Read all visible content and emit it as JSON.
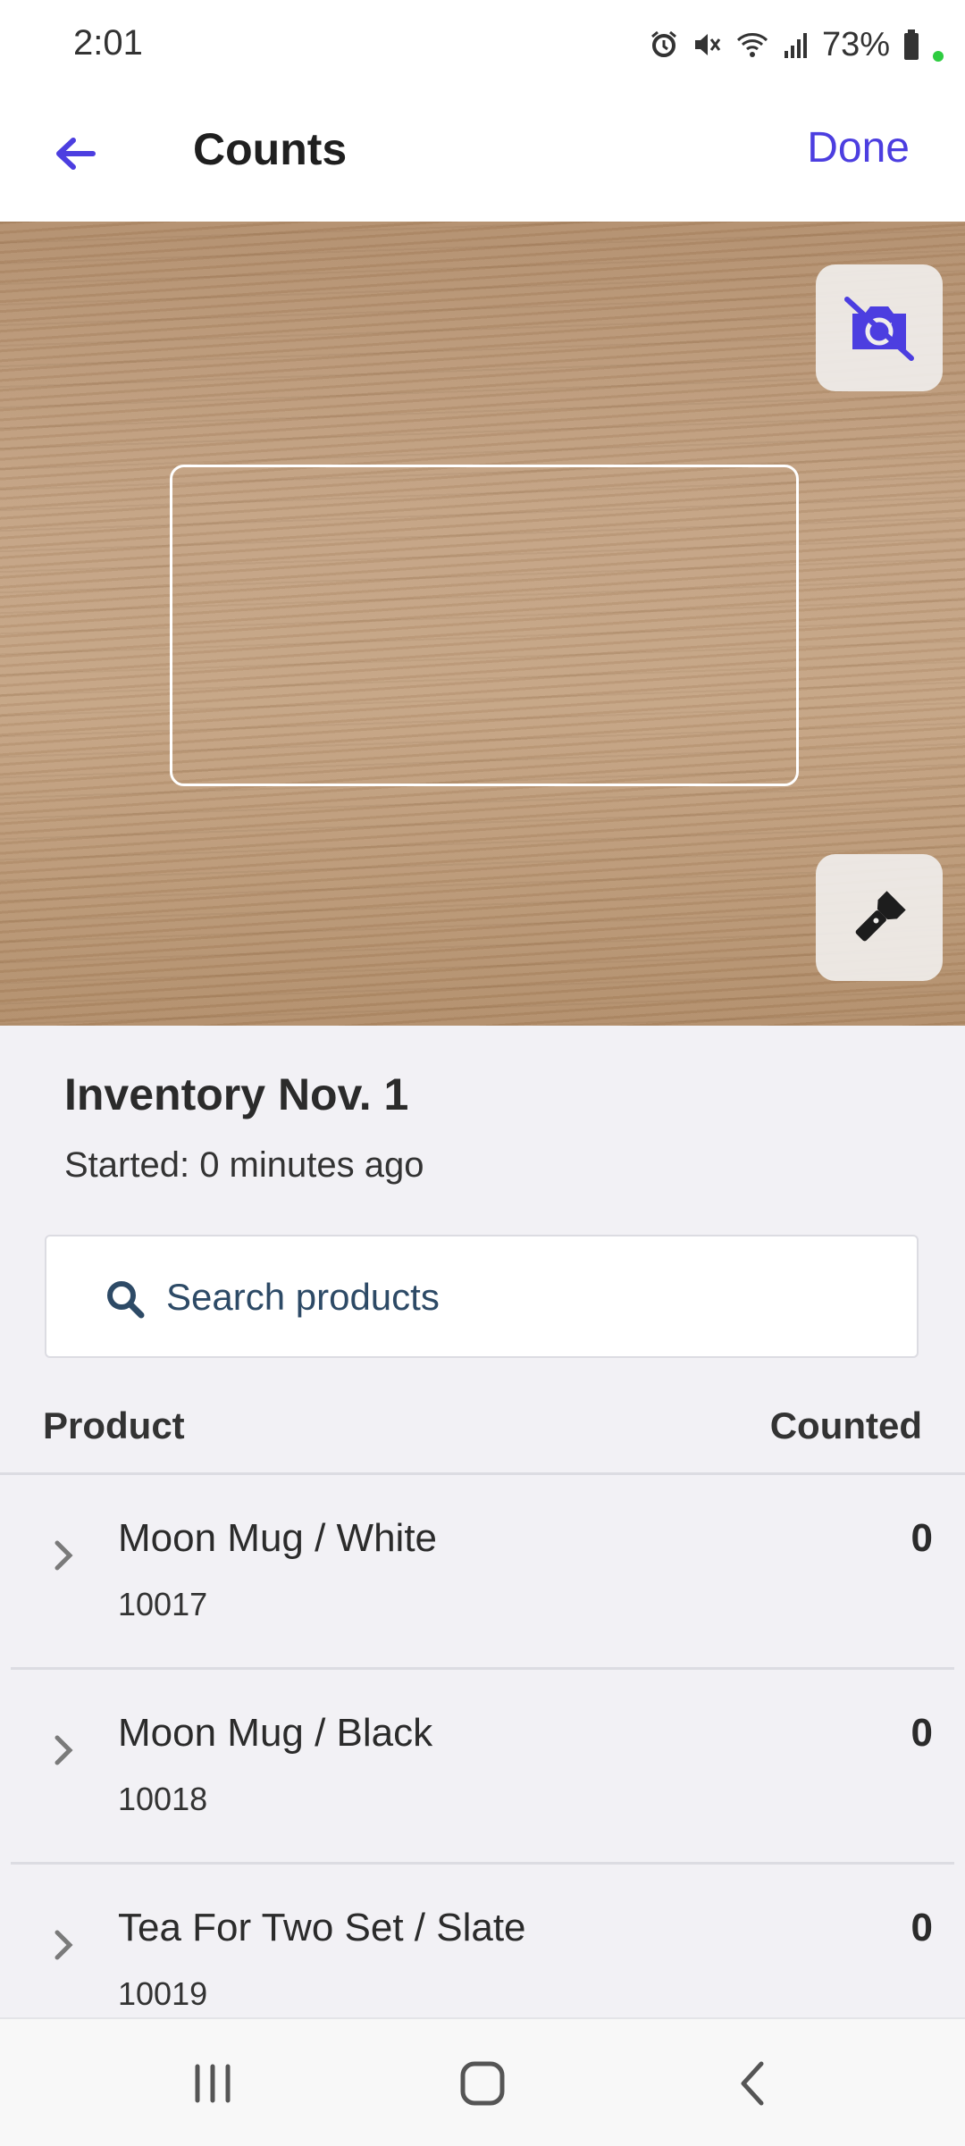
{
  "status_bar": {
    "time": "2:01",
    "battery": "73%",
    "icons": [
      "alarm-icon",
      "mute-icon",
      "wifi-icon",
      "signal-icon",
      "battery-icon"
    ]
  },
  "header": {
    "title": "Counts",
    "done_label": "Done",
    "back_icon": "back-arrow-icon"
  },
  "camera": {
    "switch_icon": "camera-switch-off-icon",
    "flashlight_icon": "flashlight-icon"
  },
  "inventory": {
    "title": "Inventory Nov. 1",
    "started": "Started: 0 minutes ago"
  },
  "search": {
    "placeholder": "Search products",
    "value": ""
  },
  "table": {
    "columns": {
      "product": "Product",
      "counted": "Counted"
    },
    "rows": [
      {
        "name": "Moon Mug / White",
        "sku": "10017",
        "count": "0"
      },
      {
        "name": "Moon Mug / Black",
        "sku": "10018",
        "count": "0"
      },
      {
        "name": "Tea For Two Set / Slate",
        "sku": "10019",
        "count": "0"
      }
    ]
  },
  "colors": {
    "accent": "#4c3ee0",
    "background": "#f2f1f5"
  }
}
